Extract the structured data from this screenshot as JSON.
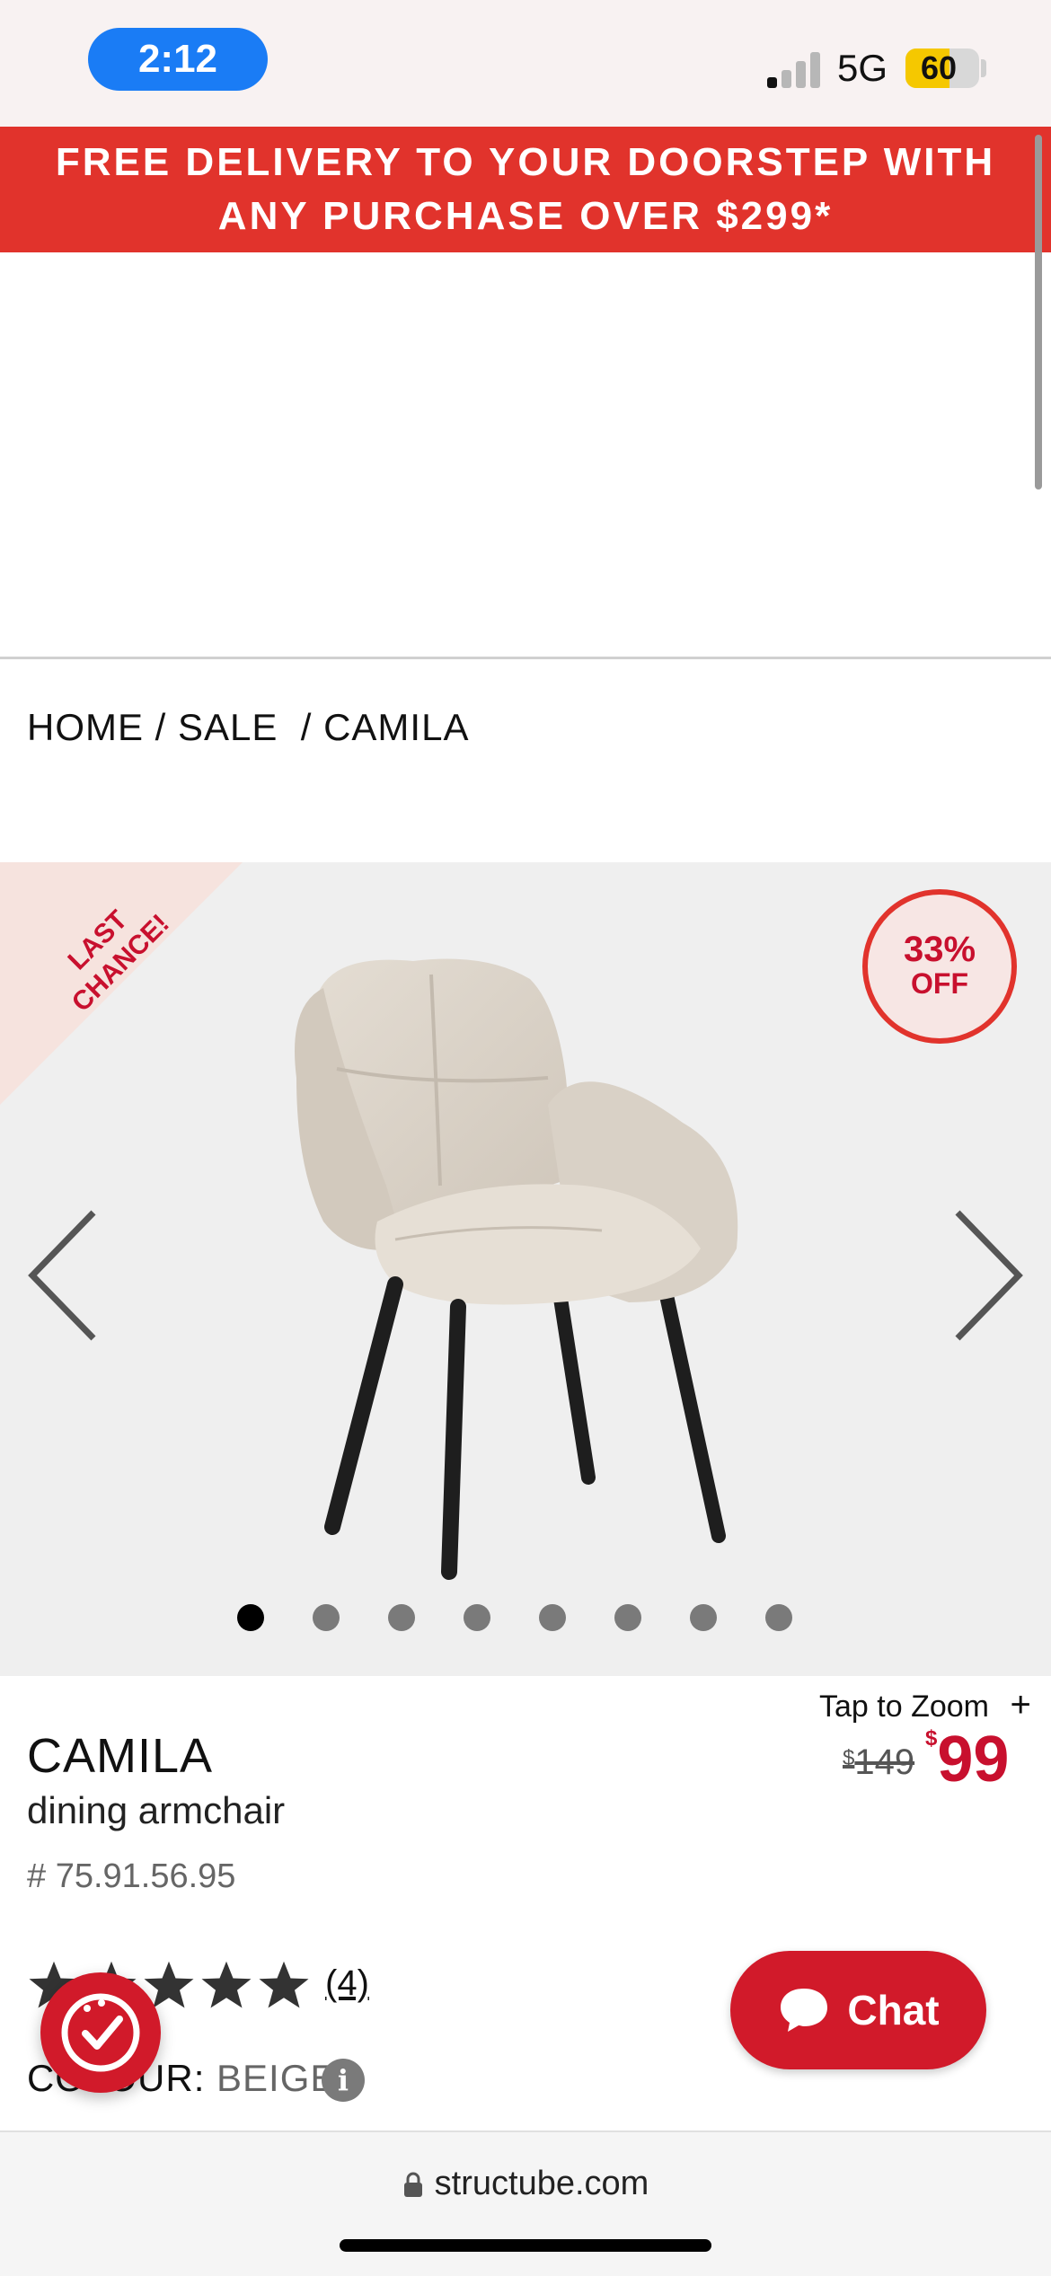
{
  "status_bar": {
    "time": "2:12",
    "network": "5G",
    "battery": "60",
    "battery_level": 0.6
  },
  "promo_banner": {
    "line1": "FREE DELIVERY TO YOUR DOORSTEP WITH",
    "line2": "ANY PURCHASE OVER $299*"
  },
  "breadcrumb": {
    "text": "HOME / SALE  / CAMILA"
  },
  "gallery": {
    "ribbon": {
      "line1": "LAST",
      "line2": "CHANCE!"
    },
    "discount": {
      "pct": "33%",
      "off": "OFF"
    },
    "dot_count": 8,
    "active_dot": 0
  },
  "product": {
    "name": "CAMILA",
    "subtitle": "dining armchair",
    "sku": "# 75.91.56.95",
    "zoom_label": "Tap to Zoom",
    "zoom_plus": "+",
    "currency": "$",
    "old_price": "149",
    "new_price": "99",
    "rating": 5,
    "reviews": "(4)",
    "colour_label": "COLOUR: ",
    "colour_value": "BEIGE"
  },
  "chat": {
    "label": "Chat"
  },
  "browser": {
    "url": "structube.com"
  },
  "colors": {
    "brand_red": "#c8102e",
    "banner_red": "#e1332c",
    "chat_red": "#d11a2a"
  }
}
